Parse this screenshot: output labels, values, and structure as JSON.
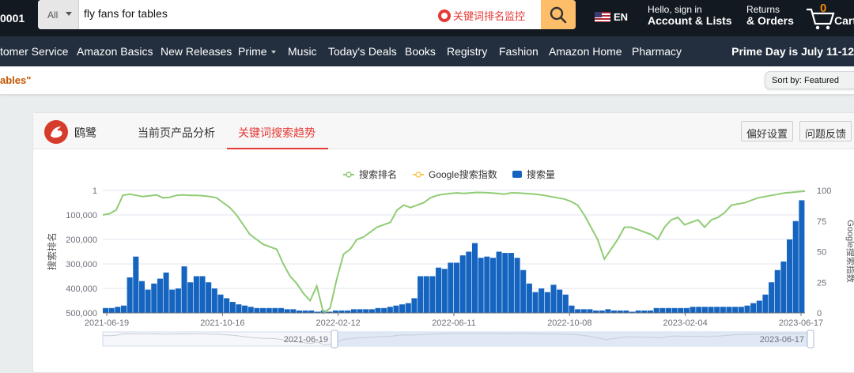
{
  "header": {
    "zip_fragment": "0001",
    "search": {
      "category": "All",
      "query": "fly fans for tables",
      "monitor_label": "关键词排名监控"
    },
    "language": "EN",
    "account": {
      "greeting": "Hello, sign in",
      "label": "Account & Lists"
    },
    "orders": {
      "top": "Returns",
      "bottom": "& Orders"
    },
    "cart": {
      "count": "0",
      "label": "Cart"
    },
    "colors": {
      "topbar": "#131921",
      "navbar": "#232f3e",
      "search_button": "#febd69",
      "cart_count": "#f08804"
    }
  },
  "nav": {
    "items": [
      "tomer Service",
      "Amazon Basics",
      "New Releases",
      "Prime",
      "Music",
      "Today's Deals",
      "Books",
      "Registry",
      "Fashion",
      "Amazon Home",
      "Pharmacy"
    ],
    "promo": "Prime Day is July 11-12"
  },
  "results": {
    "query_fragment": "ables\"",
    "sort_label": "Sort by:",
    "sort_value": "Featured"
  },
  "plugin": {
    "name": "鸥鹭",
    "tabs": [
      "当前页产品分析",
      "关键词搜索趋势"
    ],
    "active_tab": 1,
    "buttons": [
      "偏好设置",
      "问题反馈"
    ],
    "accent": "#e53935"
  },
  "chart_data": {
    "type": "bar",
    "legend": [
      "搜索排名",
      "Google搜索指数",
      "搜索量"
    ],
    "legend_placement": "top-center",
    "colors": {
      "rank": "#91cc75",
      "google": "#fac858",
      "volume": "#1565c0"
    },
    "x_ticks": [
      "2021-06-19",
      "2021-10-16",
      "2022-02-12",
      "2022-06-11",
      "2022-10-08",
      "2023-02-04",
      "2023-06-17"
    ],
    "y_left": {
      "label": "搜索排名",
      "ticks": [
        "1",
        "100,000",
        "200,000",
        "300,000",
        "400,000",
        "500,000"
      ],
      "range": [
        1,
        500000
      ],
      "inverted": true
    },
    "y_right": {
      "label": "Google搜索指数",
      "ticks": [
        "0",
        "25",
        "50",
        "75",
        "100"
      ],
      "range": [
        0,
        100
      ]
    },
    "slider": {
      "start": "2021-06-19",
      "end": "2023-06-17"
    },
    "volume": [
      4,
      4,
      5,
      6,
      29,
      46,
      26,
      19,
      24,
      28,
      33,
      19,
      20,
      38,
      25,
      30,
      30,
      25,
      20,
      15,
      12,
      9,
      7,
      6,
      5,
      4,
      4,
      4,
      4,
      4,
      3,
      3,
      2,
      2,
      2,
      1,
      2,
      1,
      2,
      2,
      2,
      3,
      3,
      3,
      3,
      4,
      4,
      5,
      6,
      7,
      8,
      12,
      30,
      30,
      30,
      37,
      36,
      41,
      41,
      47,
      50,
      57,
      45,
      46,
      45,
      50,
      49,
      49,
      45,
      35,
      24,
      17,
      20,
      17,
      23,
      19,
      15,
      6,
      3,
      3,
      3,
      2,
      2,
      3,
      2,
      2,
      2,
      1,
      2,
      2,
      2,
      4,
      4,
      4,
      4,
      4,
      4,
      5,
      5,
      5,
      5,
      5,
      5,
      5,
      5,
      5,
      6,
      8,
      10,
      15,
      25,
      35,
      42,
      60,
      75,
      92
    ],
    "rank": [
      100000,
      95000,
      80000,
      20000,
      15000,
      20000,
      25000,
      22000,
      18000,
      30000,
      28000,
      20000,
      18000,
      20000,
      20000,
      22000,
      25000,
      30000,
      50000,
      70000,
      100000,
      140000,
      180000,
      200000,
      220000,
      230000,
      240000,
      300000,
      350000,
      380000,
      420000,
      450000,
      390000,
      500000,
      480000,
      360000,
      260000,
      240000,
      200000,
      190000,
      170000,
      150000,
      140000,
      130000,
      80000,
      60000,
      70000,
      60000,
      50000,
      30000,
      20000,
      15000,
      12000,
      10000,
      12000,
      10000,
      8000,
      9000,
      10000,
      12000,
      15000,
      10000,
      10000,
      12000,
      14000,
      16000,
      20000,
      25000,
      30000,
      35000,
      45000,
      60000,
      100000,
      150000,
      200000,
      280000,
      240000,
      200000,
      150000,
      150000,
      160000,
      170000,
      180000,
      200000,
      150000,
      120000,
      110000,
      140000,
      130000,
      120000,
      150000,
      120000,
      110000,
      90000,
      60000,
      55000,
      50000,
      40000,
      30000,
      25000,
      20000,
      15000,
      10000,
      8000,
      5000,
      3000
    ]
  }
}
